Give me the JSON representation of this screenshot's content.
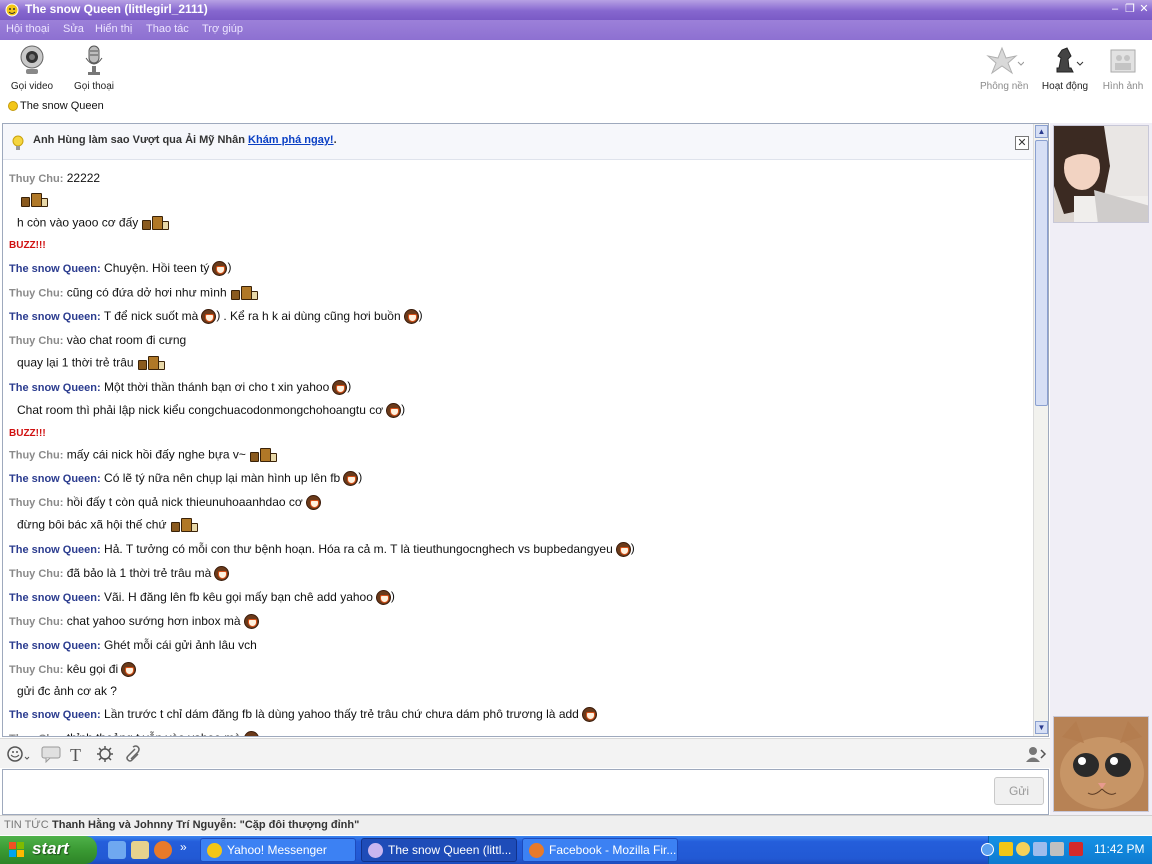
{
  "window": {
    "title": "The snow Queen (littlegirl_2111)"
  },
  "menu": [
    "Hội thoại",
    "Sửa",
    "Hiển thị",
    "Thao tác",
    "Trợ giúp"
  ],
  "toolbar": {
    "video_label": "Gọi video",
    "voice_label": "Gọi thoại",
    "background_label": "Phông nền",
    "activity_label": "Hoạt động",
    "images_label": "Hình ảnh"
  },
  "contact": {
    "name": "The snow Queen"
  },
  "banner": {
    "text": "Anh Hùng làm sao Vượt qua Ải Mỹ Nhân",
    "link": "Khám phá ngay!",
    "suffix": "."
  },
  "messages": [
    {
      "sender": "Thuy Chu:",
      "text": "22222",
      "emo": ""
    },
    {
      "sender": "",
      "text": "",
      "emo": "drink"
    },
    {
      "sender": "",
      "text": "h còn vào yaoo cơ đấy",
      "emo": "drink"
    },
    {
      "buzz": "BUZZ!!!"
    },
    {
      "sender": "The snow Queen:",
      "text": "Chuyện. Hồi teen tý",
      "emo": "laugh"
    },
    {
      "sender": "Thuy Chu:",
      "text": "cũng có đứa dở hơi như mình",
      "emo": "drink"
    },
    {
      "sender": "The snow Queen:",
      "text": "T để nick suốt mà",
      "emo": "laugh",
      "after": ". Kể ra h k ai dùng cũng hơi buồn",
      "emo2": "laugh"
    },
    {
      "sender": "Thuy Chu:",
      "text": "vào chat room đi cưng",
      "emo": ""
    },
    {
      "sender": "",
      "text": "quay lại 1 thời trẻ trâu",
      "emo": "drink"
    },
    {
      "sender": "The snow Queen:",
      "text": "Một thời thần thánh bạn ơi cho t xin yahoo",
      "emo": "laugh"
    },
    {
      "sender": "",
      "text": "Chat room thì phải lập nick kiểu congchuacodonmongchohoangtu cơ",
      "emo": "laugh"
    },
    {
      "buzz": "BUZZ!!!"
    },
    {
      "sender": "Thuy Chu:",
      "text": "mấy cái nick hồi đấy nghe bựa v~",
      "emo": "drink"
    },
    {
      "sender": "The snow Queen:",
      "text": "Có lẽ tý nữa nên chụp lại màn hình up lên fb",
      "emo": "laugh"
    },
    {
      "sender": "Thuy Chu:",
      "text": "hồi đấy t còn quả nick thieunuhoaanhdao cơ",
      "emo": "laugh-plain"
    },
    {
      "sender": "",
      "text": "đừng bôi bác xã hội thế chứ",
      "emo": "drink"
    },
    {
      "sender": "The snow Queen:",
      "text": "Hả. T tưởng có mỗi con thư bệnh hoạn. Hóa ra cả m. T là tieuthungocnghech vs bupbedangyeu",
      "emo": "laugh"
    },
    {
      "sender": "Thuy Chu:",
      "text": "đã bảo là 1 thời trẻ trâu mà",
      "emo": "laugh-plain"
    },
    {
      "sender": "The snow Queen:",
      "text": "Vãi. H đăng lên fb kêu gọi mấy bạn chê add yahoo",
      "emo": "laugh"
    },
    {
      "sender": "Thuy Chu:",
      "text": "chat yahoo sướng hơn inbox mà",
      "emo": "laugh-plain"
    },
    {
      "sender": "The snow Queen:",
      "text": "Ghét mỗi cái gửi ảnh lâu vch",
      "emo": ""
    },
    {
      "sender": "Thuy Chu:",
      "text": "kêu gọi đi",
      "emo": "laugh-plain"
    },
    {
      "sender": "",
      "text": "gửi đc ảnh cơ ak ?",
      "emo": ""
    },
    {
      "sender": "The snow Queen:",
      "text": "Lần trước t chỉ dám đăng fb là dùng yahoo thấy trẻ trâu chứ chưa dám phô trương là add",
      "emo": "laugh-plain"
    },
    {
      "sender": "Thuy Chu:",
      "text": "thỉnh thoảng t vẫn vào yahoo mà",
      "emo": "laugh-plain"
    }
  ],
  "input": {
    "send_label": "Gửi",
    "value": ""
  },
  "news": {
    "label": "TIN TỨC",
    "headline": "Thanh Hằng và Johnny Trí Nguyễn: \"Cặp đôi thượng đỉnh\""
  },
  "taskbar": {
    "start_label": "start",
    "items": [
      "Yahoo! Messenger",
      "The snow Queen (littl...",
      "Facebook - Mozilla Fir..."
    ],
    "clock": "11:42 PM"
  },
  "colors": {
    "titlebar": "#8667cf",
    "queen": "#2b3c8f",
    "thuy": "#8a8a8a",
    "buzz": "#d01010",
    "taskbar": "#245edb",
    "start": "#3a9a33"
  }
}
